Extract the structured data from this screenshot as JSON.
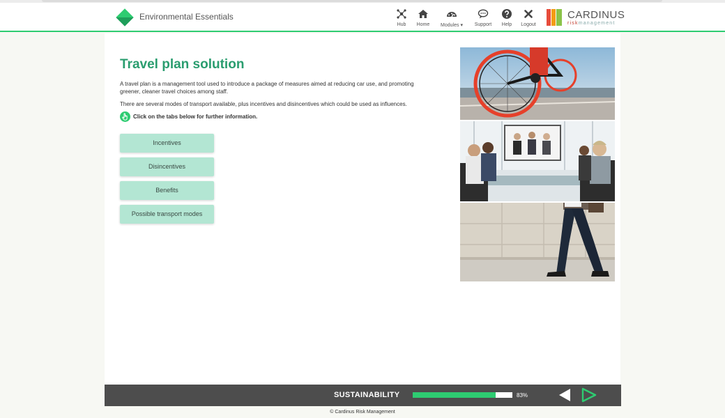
{
  "app": {
    "title": "Environmental Essentials"
  },
  "nav": [
    {
      "label": "Hub",
      "icon": "hub-icon"
    },
    {
      "label": "Home",
      "icon": "home-icon"
    },
    {
      "label": "Modules",
      "icon": "dashboard-icon",
      "has_dropdown": true
    },
    {
      "label": "Support",
      "icon": "speech-bubble-icon"
    },
    {
      "label": "Help",
      "icon": "question-icon"
    },
    {
      "label": "Logout",
      "icon": "close-icon"
    }
  ],
  "brand": {
    "name": "CARDINUS",
    "sub_a": "risk",
    "sub_b": "management",
    "bar_colors": [
      "#e74c3c",
      "#f39c12",
      "#8bc34a"
    ]
  },
  "page": {
    "title": "Travel plan solution",
    "intro": "A travel plan is a management tool used to introduce a package of measures aimed at reducing car use, and promoting greener, cleaner travel choices among staff.",
    "modes": "There are several modes of transport available, plus incentives and disincentives which could be used as influences.",
    "hint": "Click on the tabs below for further information."
  },
  "tabs": [
    "Incentives",
    "Disincentives",
    "Benefits",
    "Possible transport modes"
  ],
  "footer": {
    "section": "SUSTAINABILITY",
    "progress": 0.83,
    "progress_label": "83%"
  },
  "copyright": "Cardinus Risk Management",
  "colors": {
    "accent": "#2ecc71",
    "title": "#2a9d6f",
    "tab_bg": "#b3e6d3",
    "footer_bg": "#4d4d4d"
  }
}
